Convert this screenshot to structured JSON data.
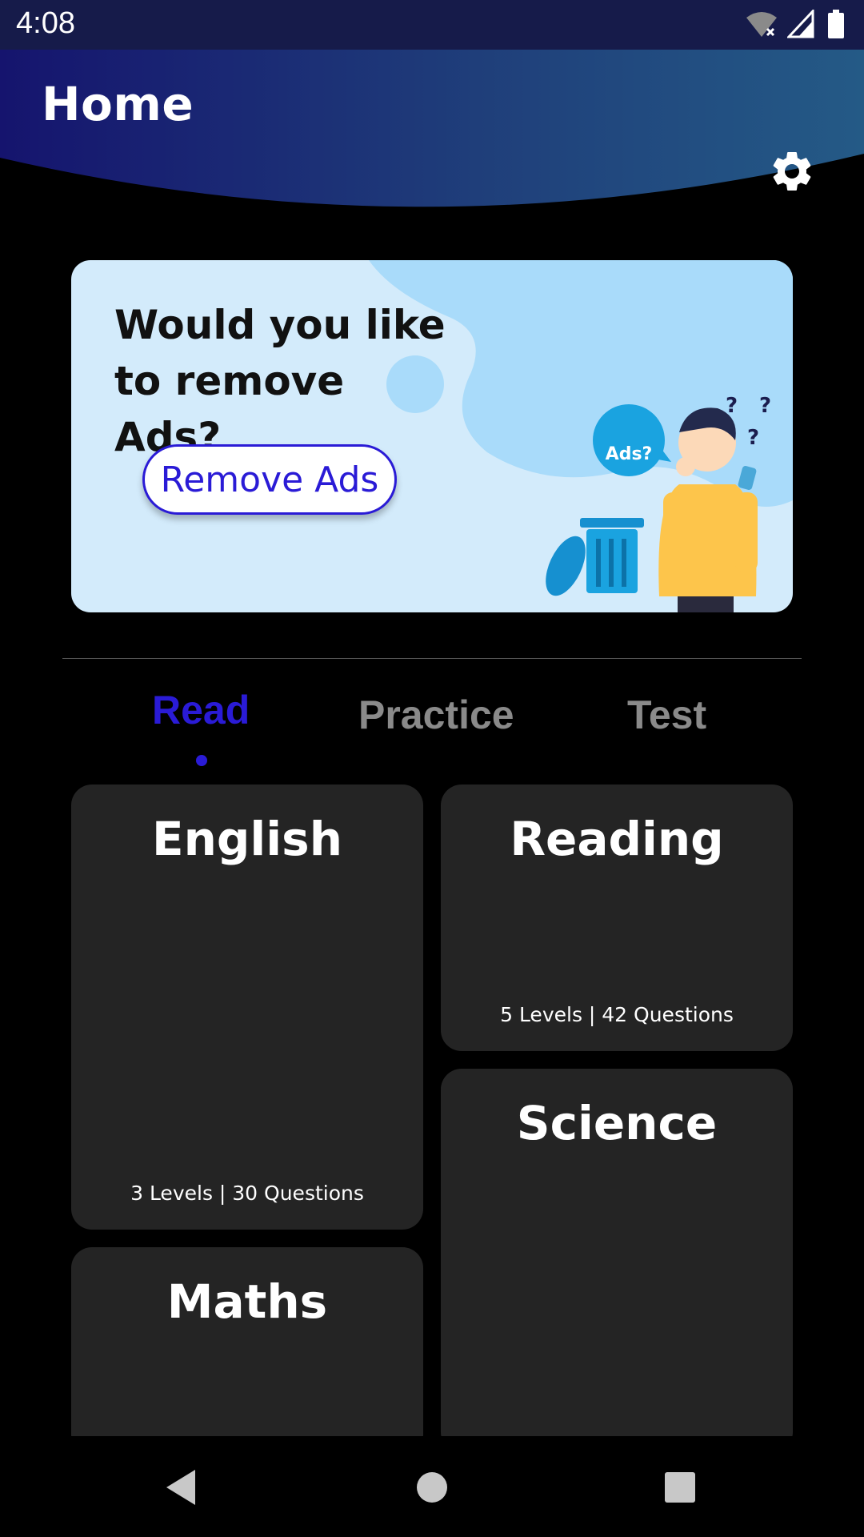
{
  "status_bar": {
    "time": "4:08",
    "icons": [
      "wifi-off-icon",
      "signal-icon",
      "battery-icon"
    ]
  },
  "header": {
    "title": "Home",
    "settings_icon": "gear-icon",
    "gradient": [
      "#15146e",
      "#1f3e7a",
      "#245a86"
    ]
  },
  "ad_banner": {
    "question": "Would you like to remove Ads?",
    "button_label": "Remove Ads",
    "bubble_text": "Ads?",
    "marks": [
      "?",
      "?",
      "?"
    ]
  },
  "tabs": [
    {
      "label": "Read",
      "active": true
    },
    {
      "label": "Practice",
      "active": false
    },
    {
      "label": "Test",
      "active": false
    }
  ],
  "cards": {
    "english": {
      "title": "English",
      "meta": "3 Levels | 30 Questions"
    },
    "reading": {
      "title": "Reading",
      "meta": "5 Levels | 42 Questions"
    },
    "science": {
      "title": "Science"
    },
    "maths": {
      "title": "Maths"
    }
  },
  "nav": {
    "icons": [
      "back-icon",
      "home-icon",
      "recents-icon"
    ]
  },
  "colors": {
    "accent": "#2a1bd6",
    "card_bg": "#242424",
    "banner_bg": "#d3ebfb"
  }
}
